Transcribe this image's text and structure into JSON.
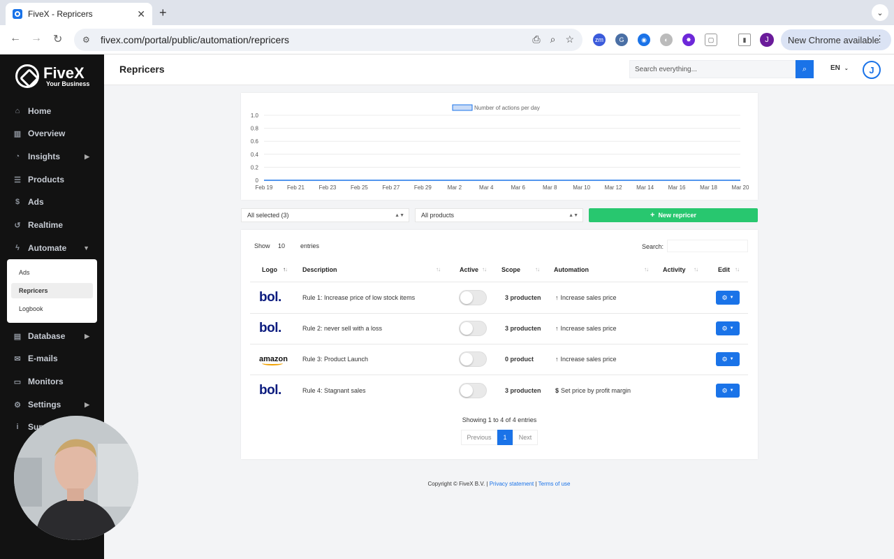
{
  "browser": {
    "tab_title": "FiveX - Repricers",
    "url": "fivex.com/portal/public/automation/repricers",
    "update_label": "New Chrome available",
    "profile_initial": "J"
  },
  "sidebar": {
    "brand": "FiveX",
    "tagline": "Your Business",
    "items": [
      {
        "label": "Home",
        "icon": "home-icon"
      },
      {
        "label": "Overview",
        "icon": "chart-icon"
      },
      {
        "label": "Insights",
        "icon": "pie-icon",
        "has_children": true
      },
      {
        "label": "Products",
        "icon": "list-icon"
      },
      {
        "label": "Ads",
        "icon": "dollar-icon"
      },
      {
        "label": "Realtime",
        "icon": "history-icon"
      },
      {
        "label": "Automate",
        "icon": "bolt-icon",
        "expanded": true
      },
      {
        "label": "Database",
        "icon": "database-icon",
        "has_children": true
      },
      {
        "label": "E-mails",
        "icon": "mail-icon"
      },
      {
        "label": "Monitors",
        "icon": "monitor-icon"
      },
      {
        "label": "Settings",
        "icon": "gear-icon",
        "has_children": true
      },
      {
        "label": "Sup",
        "icon": "info-icon"
      }
    ],
    "automate_submenu": [
      {
        "label": "Ads"
      },
      {
        "label": "Repricers",
        "active": true
      },
      {
        "label": "Logbook"
      }
    ]
  },
  "header": {
    "title": "Repricers",
    "search_placeholder": "Search everything...",
    "language": "EN",
    "avatar_initial": "J"
  },
  "chart_data": {
    "type": "line",
    "series": [
      {
        "name": "Number of actions per day",
        "values": [
          0,
          0,
          0,
          0,
          0,
          0,
          0,
          0,
          0,
          0,
          0,
          0,
          0,
          0,
          0,
          0
        ]
      }
    ],
    "categories": [
      "Feb 19",
      "Feb 21",
      "Feb 23",
      "Feb 25",
      "Feb 27",
      "Feb 29",
      "Mar 2",
      "Mar 4",
      "Mar 6",
      "Mar 8",
      "Mar 10",
      "Mar 12",
      "Mar 14",
      "Mar 16",
      "Mar 18",
      "Mar 20"
    ],
    "y_ticks": [
      "1.0",
      "0.8",
      "0.6",
      "0.4",
      "0.2",
      "0"
    ],
    "ylim": [
      0,
      1
    ],
    "legend_position": "top-center",
    "grid": true,
    "line_color": "#1a73e8"
  },
  "filters": {
    "marketplace_select": "All selected (3)",
    "product_select": "All products",
    "new_button": "New repricer"
  },
  "table": {
    "show_label": "Show",
    "page_length": "10",
    "entries_label": "entries",
    "search_label": "Search:",
    "columns": [
      "Logo",
      "Description",
      "Active",
      "Scope",
      "Automation",
      "Activity",
      "Edit"
    ],
    "rows": [
      {
        "logo": "bol.",
        "description": "Rule 1: Increase price of low stock items",
        "active": false,
        "scope": "3 producten",
        "automation_icon": "↑",
        "automation": "Increase sales price"
      },
      {
        "logo": "bol.",
        "description": "Rule 2: never sell with a loss",
        "active": false,
        "scope": "3 producten",
        "automation_icon": "↑",
        "automation": "Increase sales price"
      },
      {
        "logo": "amazon",
        "description": "Rule 3: Product Launch",
        "active": false,
        "scope": "0 product",
        "automation_icon": "↑",
        "automation": "Increase sales price"
      },
      {
        "logo": "bol.",
        "description": "Rule 4: Stagnant sales",
        "active": false,
        "scope": "3 producten",
        "automation_icon": "$",
        "automation": "Set price by profit margin"
      }
    ],
    "info": "Showing 1 to 4 of 4 entries",
    "pagination": {
      "previous": "Previous",
      "current": "1",
      "next": "Next"
    }
  },
  "footer": {
    "copyright": "Copyright © FiveX B.V. |",
    "privacy": "Privacy statement",
    "separator": "|",
    "terms": "Terms of use"
  }
}
